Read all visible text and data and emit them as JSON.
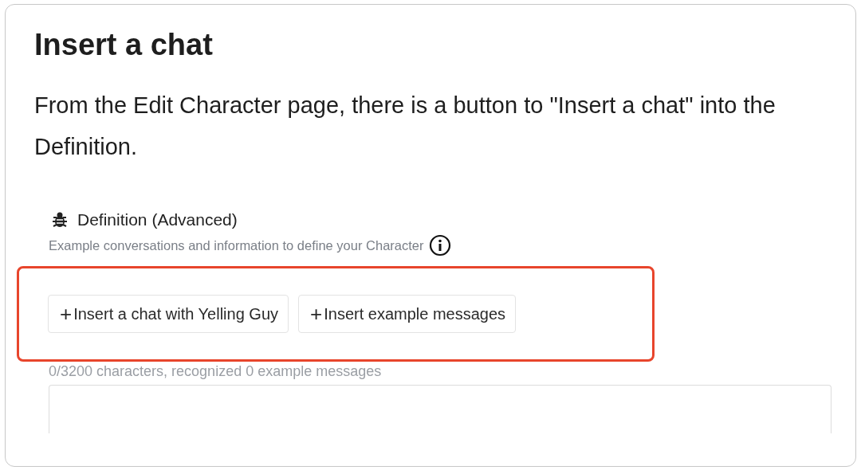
{
  "title": "Insert a chat",
  "intro": "From the Edit Character page, there is a button to \"Insert a chat\" into the Definition.",
  "field": {
    "label": "Definition (Advanced)",
    "description": "Example conversations and information to define your Character",
    "buttons": [
      {
        "icon": "+",
        "label": "Insert a chat with Yelling Guy"
      },
      {
        "icon": "+",
        "label": "Insert example messages"
      }
    ],
    "counter": "0/3200 characters, recognized 0 example messages"
  }
}
